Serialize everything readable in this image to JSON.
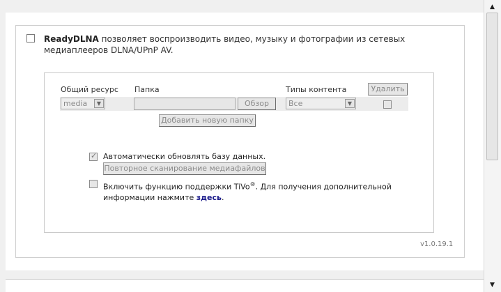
{
  "intro": {
    "product": "ReadyDLNA",
    "text_line1": " позволяет воспроизводить видео, музыку и фотографии из сетевых",
    "text_line2": "медиаплееров DLNA/UPnP AV."
  },
  "columns": {
    "share": "Общий ресурс",
    "folder": "Папка",
    "content_types": "Типы контента"
  },
  "row": {
    "share_value": "media",
    "folder_value": "",
    "content_value": "Все"
  },
  "buttons": {
    "delete": "Удалить",
    "browse": "Обзор",
    "add_folder": "Добавить новую папку",
    "rescan": "Повторное сканирование медиафайлов"
  },
  "options": {
    "auto_update_label": "Автоматически обновлять базу данных.",
    "auto_update_checked": true,
    "tivo_label_part1": "Включить функцию поддержки TiVo",
    "tivo_sup": "®",
    "tivo_label_part2": ". Для получения дополнительной",
    "tivo_label_line2": "информации нажмите ",
    "tivo_link": "здесь",
    "tivo_label_end": ".",
    "tivo_checked": false
  },
  "version": "v1.0.19.1",
  "icons": {
    "dropdown_arrow": "▼",
    "scroll_up": "▲",
    "scroll_down": "▼",
    "check": "✓"
  }
}
